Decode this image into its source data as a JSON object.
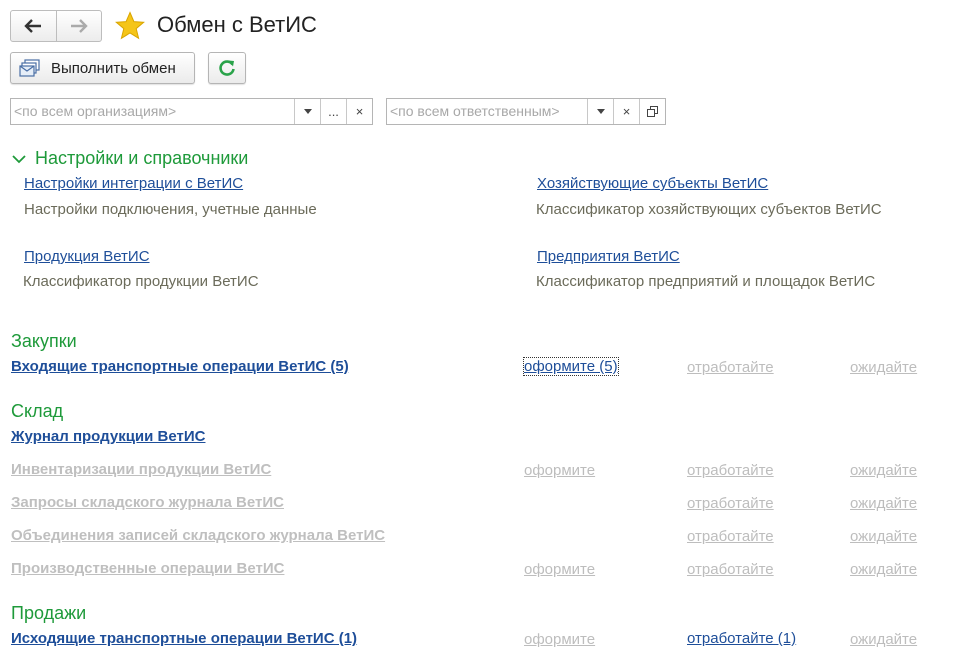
{
  "header": {
    "title": "Обмен с ВетИС",
    "back_icon": "arrow-left-icon",
    "forward_icon": "arrow-right-icon",
    "favorite_icon": "star-icon"
  },
  "toolbar": {
    "exchange_label": "Выполнить обмен",
    "refresh_icon": "refresh-icon"
  },
  "filters": {
    "organizations_placeholder": "<по всем организациям>",
    "responsible_placeholder": "<по всем ответственным>",
    "select_more": "...",
    "clear": "×"
  },
  "settings": {
    "title": "Настройки и справочники",
    "items": [
      {
        "link": "Настройки интеграции с ВетИС",
        "desc": "Настройки подключения, учетные данные"
      },
      {
        "link": "Хозяйствующие субъекты ВетИС",
        "desc": "Классификатор хозяйствующих субъектов ВетИС"
      },
      {
        "link": "Продукция ВетИС",
        "desc": "Классификатор продукции ВетИС"
      },
      {
        "link": "Предприятия ВетИС",
        "desc": "Классификатор предприятий и площадок ВетИС"
      }
    ]
  },
  "purchases": {
    "title": "Закупки",
    "rows": [
      {
        "name": "Входящие транспортные операции ВетИС (5)",
        "issue": "оформите (5)",
        "work": "отработайте",
        "wait": "ожидайте"
      }
    ]
  },
  "warehouse": {
    "title": "Склад",
    "rows": [
      {
        "name": "Журнал продукции ВетИС",
        "issue": "",
        "work": "",
        "wait": ""
      },
      {
        "name": "Инвентаризации продукции ВетИС",
        "issue": "оформите",
        "work": "отработайте",
        "wait": "ожидайте"
      },
      {
        "name": "Запросы складского журнала ВетИС",
        "issue": "",
        "work": "отработайте",
        "wait": "ожидайте"
      },
      {
        "name": "Объединения записей складского журнала ВетИС",
        "issue": "",
        "work": "отработайте",
        "wait": "ожидайте"
      },
      {
        "name": "Производственные операции ВетИС",
        "issue": "оформите",
        "work": "отработайте",
        "wait": "ожидайте"
      }
    ]
  },
  "sales": {
    "title": "Продажи",
    "rows": [
      {
        "name": "Исходящие транспортные операции ВетИС (1)",
        "issue": "оформите",
        "work": "отработайте (1)",
        "wait": "ожидайте"
      }
    ]
  },
  "colors": {
    "section_green": "#1e9a3a",
    "link_blue": "#1e4e99",
    "disabled_gray": "#bdbdbd",
    "star_yellow": "#f5c518"
  }
}
